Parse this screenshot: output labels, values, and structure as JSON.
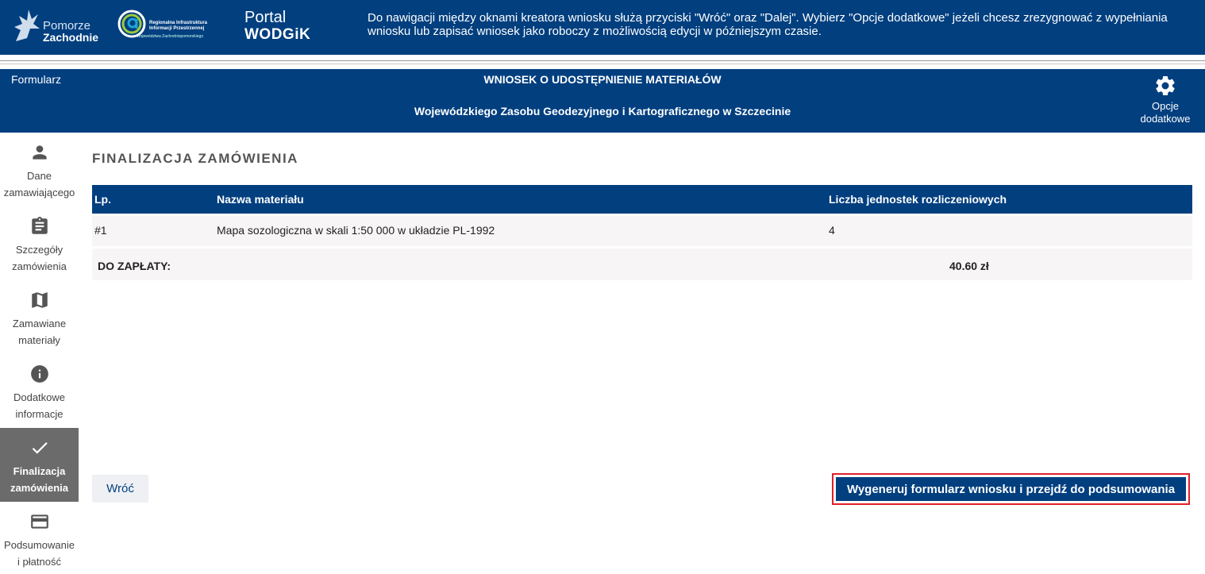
{
  "header": {
    "logo1_line1": "Pomorze",
    "logo1_line2": "Zachodnie",
    "logo2_line1": "Regionalna Infrastruktura",
    "logo2_line2": "Informacji Przestrzennej",
    "logo2_line3": "Województwa Zachodniopomorskiego",
    "portal_line1": "Portal",
    "portal_line2": "WODGiK",
    "hint": "Do nawigacji między oknami kreatora wniosku służą przyciski \"Wróć\" oraz \"Dalej\". Wybierz \"Opcje dodatkowe\" jeżeli chcesz zrezygnować z wypełniania wniosku lub zapisać wniosek jako roboczy z możliwością edycji w późniejszym czasie."
  },
  "form_header": {
    "label": "Formularz",
    "title": "WNIOSEK O UDOSTĘPNIENIE MATERIAŁÓW",
    "subtitle": "Wojewódzkiego Zasobu Geodezyjnego i Kartograficznego w Szczecinie",
    "options_line1": "Opcje",
    "options_line2": "dodatkowe",
    "options_icon": "gear-icon"
  },
  "sidebar": {
    "items": [
      {
        "line1": "Dane",
        "line2": "zamawiającego",
        "icon": "person-icon",
        "active": false
      },
      {
        "line1": "Szczegóły",
        "line2": "zamówienia",
        "icon": "clipboard-icon",
        "active": false
      },
      {
        "line1": "Zamawiane",
        "line2": "materiały",
        "icon": "map-icon",
        "active": false
      },
      {
        "line1": "Dodatkowe",
        "line2": "informacje",
        "icon": "info-icon",
        "active": false
      },
      {
        "line1": "Finalizacja",
        "line2": "zamówienia",
        "icon": "check-icon",
        "active": true
      },
      {
        "line1": "Podsumowanie",
        "line2": "i płatność",
        "icon": "credit-card-icon",
        "active": false
      }
    ]
  },
  "main": {
    "title": "FINALIZACJA ZAMÓWIENIA",
    "table": {
      "columns": [
        "Lp.",
        "Nazwa materiału",
        "Liczba jednostek rozliczeniowych"
      ],
      "rows": [
        [
          "#1",
          "Mapa sozologiczna w skali 1:50 000 w układzie PL-1992",
          "4"
        ]
      ]
    },
    "total_label": "DO ZAPŁATY:",
    "total_value": "40.60 zł"
  },
  "buttons": {
    "back": "Wróć",
    "generate": "Wygeneruj formularz wniosku i przejdź do podsumowania"
  },
  "colors": {
    "primary": "#013f7f",
    "active_step": "#6b6b6b",
    "highlight": "#e0202a"
  }
}
